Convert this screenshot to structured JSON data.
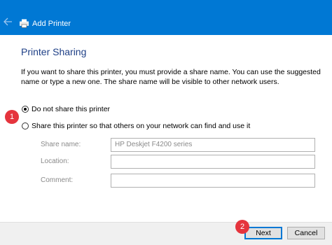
{
  "window": {
    "title": "Add Printer"
  },
  "page": {
    "heading": "Printer Sharing",
    "instructions": "If you want to share this printer, you must provide a share name. You can use the suggested name or type a new one. The share name will be visible to other network users."
  },
  "options": {
    "no_share_label": "Do not share this printer",
    "share_label": "Share this printer so that others on your network can find and use it",
    "selected": "no_share"
  },
  "fields": {
    "share_name_label": "Share name:",
    "share_name_value": "HP Deskjet F4200 series",
    "location_label": "Location:",
    "location_value": "",
    "comment_label": "Comment:",
    "comment_value": ""
  },
  "buttons": {
    "next": "Next",
    "cancel": "Cancel"
  },
  "markers": {
    "one": "1",
    "two": "2"
  },
  "colors": {
    "accent": "#0078d4",
    "marker": "#e5343d",
    "heading": "#1e3f86"
  }
}
